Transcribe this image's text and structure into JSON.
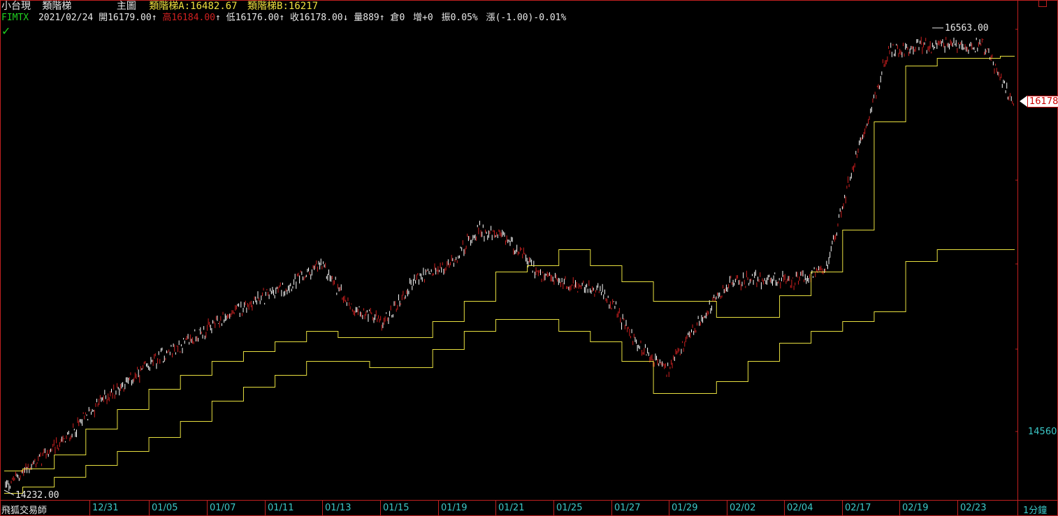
{
  "header": {
    "name": "小台現",
    "indicator": "類階梯",
    "panel": "主圖",
    "ind_a_label": "類階梯A:",
    "ind_a_value": "16482.67",
    "ind_b_label": "類階梯B:",
    "ind_b_value": "16217"
  },
  "quote": {
    "symbol": "FIMTX",
    "date": "2021/02/24",
    "open_label": "開",
    "open": "16179.00",
    "open_arrow": "↑",
    "high_label": "高",
    "high": "16184.00",
    "high_arrow": "↑",
    "low_label": "低",
    "low": "16176.00",
    "low_arrow": "↑",
    "close_label": "收",
    "close": "16178.00",
    "close_arrow": "↓",
    "volume_label": "量",
    "volume": "889",
    "volume_arrow": "↑",
    "oi_label": "倉",
    "oi": "0",
    "oi_change_label": "增",
    "oi_change": "+0",
    "amplitude_label": "振",
    "amplitude": "0.05%",
    "change_label": "漲",
    "change": "(-1.00)-0.01%"
  },
  "status_icon": "checkmark-icon",
  "footer": {
    "provider": "飛狐交易師",
    "interval": "1分鐘"
  },
  "colors": {
    "background": "#000000",
    "candle_up": "#ffffff",
    "candle_down": "#d02020",
    "ladder": "#e8e040",
    "axis": "#c02020",
    "axis_text": "#3cc8c8"
  },
  "chart_data": {
    "type": "candlestick",
    "x_ticks": [
      "12/31",
      "01/05",
      "01/07",
      "01/11",
      "01/13",
      "01/15",
      "01/19",
      "01/21",
      "01/25",
      "01/27",
      "01/29",
      "02/02",
      "02/04",
      "02/17",
      "02/19",
      "02/23"
    ],
    "y_ticks": [
      14560
    ],
    "ylim": [
      14232,
      16563
    ],
    "annotations": {
      "max": "16563.00",
      "min": "14232.00"
    },
    "last_price": "16178",
    "series": [
      {
        "name": "類階梯A",
        "x": [
          "12/30",
          "12/31",
          "01/04",
          "01/05",
          "01/06",
          "01/07",
          "01/08",
          "01/11",
          "01/12",
          "01/13",
          "01/14",
          "01/15",
          "01/18",
          "01/19",
          "01/20",
          "01/21",
          "01/22",
          "01/25",
          "01/26",
          "01/27",
          "01/28",
          "01/29",
          "02/01",
          "02/02",
          "02/03",
          "02/04",
          "02/05",
          "02/17",
          "02/18",
          "02/19",
          "02/22",
          "02/23",
          "02/24"
        ],
        "values": [
          14350,
          14360,
          14430,
          14560,
          14660,
          14760,
          14830,
          14900,
          14950,
          15000,
          15050,
          15020,
          15020,
          15020,
          15100,
          15200,
          15350,
          15380,
          15460,
          15380,
          15300,
          15200,
          15200,
          15120,
          15120,
          15230,
          15350,
          15560,
          16100,
          16380,
          16420,
          16420,
          16430
        ]
      },
      {
        "name": "類階梯B",
        "x": [
          "12/30",
          "12/31",
          "01/04",
          "01/05",
          "01/06",
          "01/07",
          "01/08",
          "01/11",
          "01/12",
          "01/13",
          "01/14",
          "01/15",
          "01/18",
          "01/19",
          "01/20",
          "01/21",
          "01/22",
          "01/25",
          "01/26",
          "01/27",
          "01/28",
          "01/29",
          "02/01",
          "02/02",
          "02/03",
          "02/04",
          "02/05",
          "02/17",
          "02/18",
          "02/19",
          "02/22",
          "02/23",
          "02/24"
        ],
        "values": [
          14240,
          14270,
          14320,
          14380,
          14450,
          14520,
          14600,
          14700,
          14770,
          14830,
          14900,
          14900,
          14870,
          14870,
          14960,
          15050,
          15110,
          15110,
          15050,
          15000,
          14900,
          14740,
          14740,
          14800,
          14900,
          14990,
          15050,
          15100,
          15150,
          15400,
          15460,
          15460,
          15460
        ]
      }
    ],
    "price_path": {
      "x": [
        "12/30",
        "12/31",
        "01/04",
        "01/05",
        "01/06",
        "01/07",
        "01/08",
        "01/11",
        "01/12",
        "01/13",
        "01/14",
        "01/15",
        "01/18",
        "01/19",
        "01/20",
        "01/21",
        "01/22",
        "01/25",
        "01/26",
        "01/27",
        "01/28",
        "01/29",
        "02/01",
        "02/02",
        "02/03",
        "02/04",
        "02/05",
        "02/17",
        "02/18",
        "02/19",
        "02/22",
        "02/23",
        "02/24"
      ],
      "close": [
        14270,
        14400,
        14520,
        14700,
        14810,
        14930,
        15020,
        15120,
        15210,
        15280,
        15380,
        15170,
        15090,
        15310,
        15370,
        15560,
        15500,
        15320,
        15280,
        15240,
        14990,
        14850,
        15100,
        15300,
        15310,
        15300,
        15350,
        15950,
        16450,
        16480,
        16480,
        16490,
        16178
      ]
    }
  }
}
